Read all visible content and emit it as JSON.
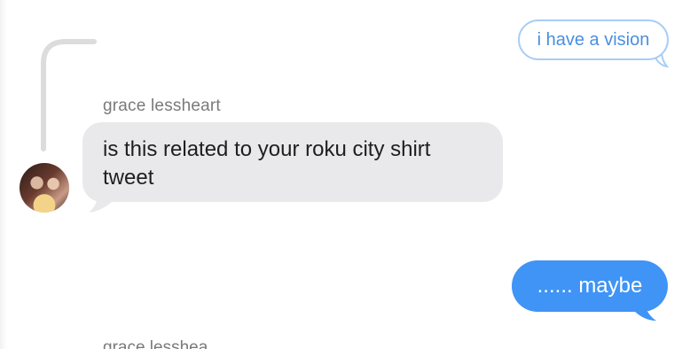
{
  "messages": {
    "reply_preview": "i have a vision",
    "sender_name": "grace lessheart",
    "incoming_text": "is this related to your roku city shirt tweet",
    "outgoing_text": "...... maybe",
    "next_sender_partial": "grace lesshea"
  },
  "colors": {
    "outgoing_blue": "#3f94f5",
    "incoming_gray": "#e9e9eb",
    "reply_outline": "#a9cdf5"
  }
}
